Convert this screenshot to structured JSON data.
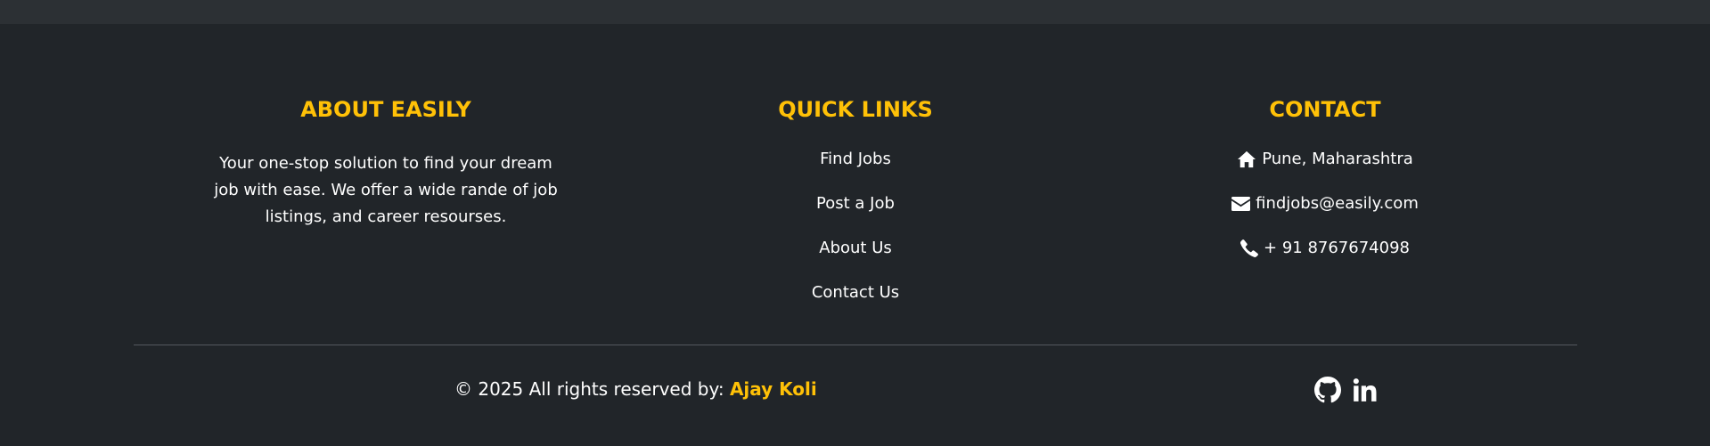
{
  "about": {
    "heading": "ABOUT EASILY",
    "text": "Your one-stop solution to find your dream job with ease. We offer a wide rande of job listings, and career resourses."
  },
  "quick_links": {
    "heading": "QUICK LINKS",
    "items": [
      {
        "label": "Find Jobs"
      },
      {
        "label": "Post a Job"
      },
      {
        "label": "About Us"
      },
      {
        "label": "Contact Us"
      }
    ]
  },
  "contact": {
    "heading": "CONTACT",
    "items": [
      {
        "icon": "home-icon",
        "text": "Pune, Maharashtra"
      },
      {
        "icon": "envelope-icon",
        "text": "findjobs@easily.com"
      },
      {
        "icon": "phone-icon",
        "text": "+ 91 8767674098"
      }
    ]
  },
  "bottom": {
    "copyright": "© 2025 All rights reserved by: ",
    "author": "Ajay Koli",
    "social": [
      {
        "icon": "github-icon"
      },
      {
        "icon": "linkedin-icon"
      }
    ]
  },
  "colors": {
    "background": "#212529",
    "topbar": "#2c3034",
    "accent": "#ffc107",
    "text": "#ffffff"
  }
}
